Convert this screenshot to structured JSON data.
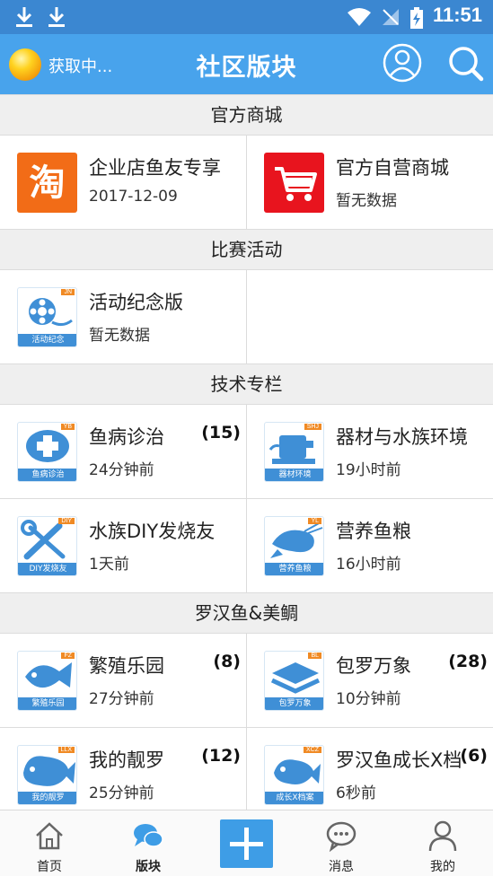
{
  "status_bar": {
    "time": "11:51",
    "icons": [
      "download-icon",
      "download-icon",
      "wifi-icon",
      "no-signal-icon",
      "battery-charging-icon"
    ]
  },
  "header": {
    "status_label": "获取中...",
    "title": "社区版块",
    "avatar_icon": "user-icon",
    "search_icon": "search-icon"
  },
  "sections": [
    {
      "title": "官方商城",
      "rows": [
        [
          {
            "name": "企业店鱼友专享",
            "sub": "2017-12-09",
            "icon": "taobao-icon",
            "icon_color": "#f26c17"
          },
          {
            "name": "官方自营商城",
            "sub": "暂无数据",
            "icon": "shopping-cart-icon",
            "icon_color": "#e8141e"
          }
        ]
      ]
    },
    {
      "title": "比赛活动",
      "rows": [
        [
          {
            "name": "活动纪念版",
            "sub": "暂无数据",
            "icon": "film-reel-icon",
            "abbr": "JN",
            "caption": "活动纪念"
          }
        ]
      ]
    },
    {
      "title": "技术专栏",
      "rows": [
        [
          {
            "name": "鱼病诊治",
            "sub": "24分钟前",
            "count": "(15)",
            "icon": "medical-cross-icon",
            "abbr": "YB",
            "caption": "鱼病诊治"
          },
          {
            "name": "器材与水族环境",
            "sub": "19小时前",
            "icon": "aquarium-equipment-icon",
            "abbr": "SHJ",
            "caption": "器材环境"
          }
        ],
        [
          {
            "name": "水族DIY发烧友",
            "sub": "1天前",
            "icon": "tools-icon",
            "abbr": "DIY",
            "caption": "DIY发烧友"
          },
          {
            "name": "营养鱼粮",
            "sub": "16小时前",
            "icon": "shrimp-icon",
            "abbr": "YL",
            "caption": "营养鱼粮"
          }
        ]
      ]
    },
    {
      "title": "罗汉鱼&美鲷",
      "rows": [
        [
          {
            "name": "繁殖乐园",
            "sub": "27分钟前",
            "count": "(8)",
            "icon": "fish-icon",
            "abbr": "FZ",
            "caption": "繁殖乐园"
          },
          {
            "name": "包罗万象",
            "sub": "10分钟前",
            "count": "(28)",
            "icon": "layers-icon",
            "abbr": "BL",
            "caption": "包罗万象"
          }
        ],
        [
          {
            "name": "我的靓罗",
            "sub": "25分钟前",
            "count": "(12)",
            "icon": "flowerhorn-fish-icon",
            "abbr": "LLX",
            "caption": "我的靓罗"
          },
          {
            "name": "罗汉鱼成长X档",
            "sub": "6秒前",
            "count": "(6)",
            "icon": "flowerhorn-growth-icon",
            "abbr": "XCZ",
            "caption": "成长X档案"
          }
        ]
      ]
    }
  ],
  "bottom_nav": {
    "items": [
      {
        "label": "首页",
        "icon": "home-icon"
      },
      {
        "label": "版块",
        "icon": "chat-bubbles-icon",
        "active": true
      },
      {
        "label": "",
        "icon": "plus-icon"
      },
      {
        "label": "消息",
        "icon": "message-icon"
      },
      {
        "label": "我的",
        "icon": "person-icon"
      }
    ]
  },
  "colors": {
    "status_bar": "#3b87d1",
    "header": "#48a3ec",
    "section_bg": "#efefef",
    "accent": "#3e9de6"
  }
}
